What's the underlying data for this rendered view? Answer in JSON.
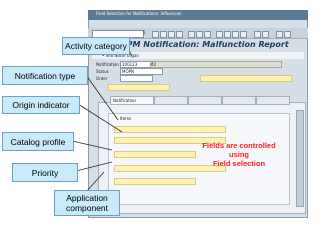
{
  "window": {
    "title": "Field Selection for Notifications: Influences"
  },
  "toolbar": {
    "counter": "5"
  },
  "heading": "Create PM Notification: Malfunction Report",
  "appbar": {
    "label": "• Info Notfn   Organ"
  },
  "fields": {
    "notification_label": "Notification",
    "notification_value": "100123",
    "notification_type": "M2",
    "status_label": "Status",
    "status_value": "MOPN",
    "order_label": "Order"
  },
  "tabs": {
    "notification": "Notification",
    "items": "Items"
  },
  "callouts": {
    "activity_category": "Activity category",
    "notification_type": "Notification type",
    "origin_indicator": "Origin indicator",
    "catalog_profile": "Catalog profile",
    "priority": "Priority",
    "application_component": "Application\ncomponent"
  },
  "note": {
    "line1": "Fields are controlled",
    "line2": "using",
    "line3": "Field selection"
  },
  "colors": {
    "callout_fill": "#c9eaf9",
    "note_text": "#ff2020",
    "heading_text": "#1e3c6b"
  }
}
